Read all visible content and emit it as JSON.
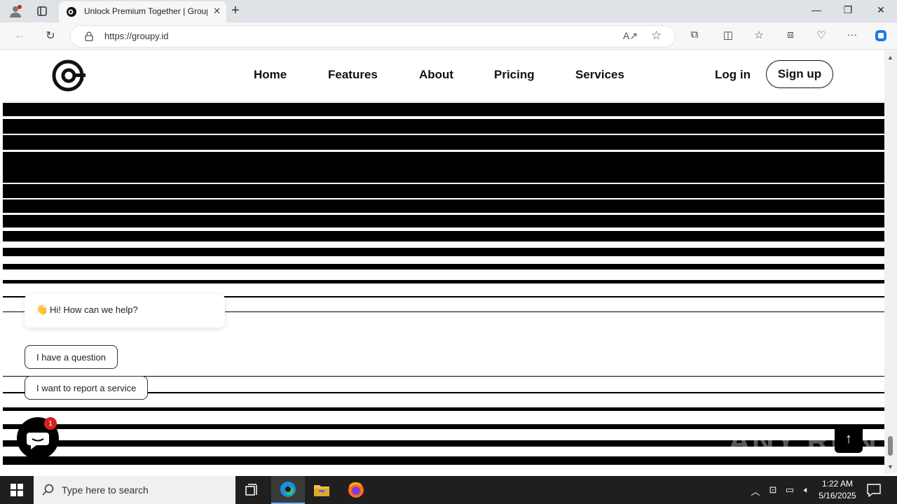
{
  "browser": {
    "tab_title": "Unlock Premium Together | Groupy",
    "url": "https://groupy.id"
  },
  "site": {
    "nav": [
      {
        "label": "Home"
      },
      {
        "label": "Features"
      },
      {
        "label": "About"
      },
      {
        "label": "Pricing"
      },
      {
        "label": "Services"
      }
    ],
    "login_label": "Log in",
    "signup_label": "Sign up"
  },
  "chat": {
    "greeting": "Hi! How can we help?",
    "options": [
      {
        "label": "I have a question"
      },
      {
        "label": "I want to report a service"
      }
    ],
    "badge_count": "1"
  },
  "watermark": "ANY RUN",
  "taskbar": {
    "search_placeholder": "Type here to search",
    "time": "1:22 AM",
    "date": "5/16/2025"
  },
  "colors": {
    "accent_blue": "#0b57d0",
    "badge_red": "#d62020"
  }
}
